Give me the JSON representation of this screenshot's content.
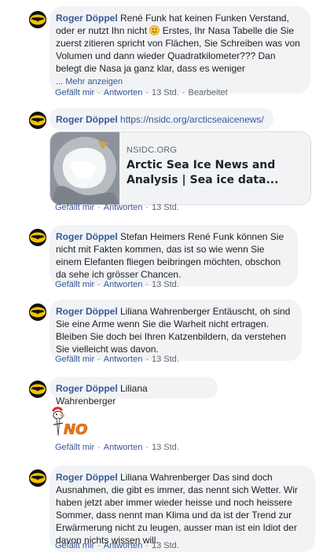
{
  "comments": [
    {
      "author": "Roger Döppel",
      "text_a": " René Funk hat keinen Funken Verstand, oder er nutzt Ihn nicht ",
      "text_b": " Erstes, Ihr Nasa Tabelle die Sie zuerst zitieren spricht von Flächen, Sie Schreiben was von Volumen und dann wieder Quadratkilometer??? Dan belegt die Nasa ja ganz klar, dass es weniger",
      "more": "... Mehr anzeigen",
      "like": "Gefällt mir",
      "reply": "Antworten",
      "time": "13 Std.",
      "edited": "Bearbeitet"
    },
    {
      "author": "Roger Döppel",
      "link": "https://nsidc.org/arcticseaicenews/",
      "card_domain": "NSIDC.ORG",
      "card_title": "Arctic Sea Ice News and Analysis | Sea ice data...",
      "like": "Gefällt mir",
      "reply": "Antworten",
      "time": "13 Std."
    },
    {
      "author": "Roger Döppel",
      "text": " Stefan Heimers René Funk können Sie nicht mit Fakten kommen, das ist so wie wenn Sie einem Elefanten fliegen beibringen möchten, obschon da sehe ich grösser Chancen.",
      "like": "Gefällt mir",
      "reply": "Antworten",
      "time": "13 Std."
    },
    {
      "author": "Roger Döppel",
      "text": " Liliana Wahrenberger Entäuscht, oh sind Sie eine Arme wenn Sie die Warheit nicht ertragen. Bleiben Sie doch bei Ihren Katzenbildern, da verstehen Sie vielleicht was davon.",
      "like": "Gefällt mir",
      "reply": "Antworten",
      "time": "13 Std."
    },
    {
      "author": "Roger Döppel",
      "text": " Liliana Wahrenberger",
      "sticker_text": "NO",
      "like": "Gefällt mir",
      "reply": "Antworten",
      "time": "13 Std."
    },
    {
      "author": "Roger Döppel",
      "text": " Liliana Wahrenberger Das sind doch Ausnahmen, die gibt es immer, das nennt sich Wetter. Wir haben jetzt aber immer wieder heisse und noch heissere Sommer, dass nennt man Klima und da ist der Trend zur Erwärmerung nicht zu leugen, ausser man ist ein Idiot der davon nichts wissen will.",
      "like": "Gefällt mir",
      "reply": "Antworten",
      "time": "13 Std."
    }
  ],
  "icons": {
    "avatar": "batman-logo",
    "emoji": "smiley-emoji"
  },
  "colors": {
    "link": "#385898",
    "bubble": "#f2f3f5",
    "meta": "#606770"
  }
}
